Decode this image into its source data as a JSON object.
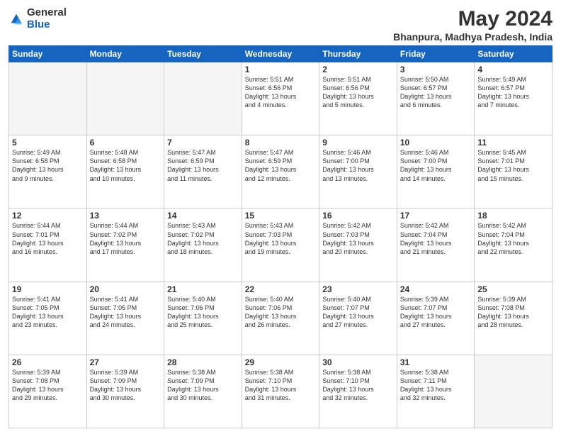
{
  "logo": {
    "general": "General",
    "blue": "Blue"
  },
  "title": "May 2024",
  "subtitle": "Bhanpura, Madhya Pradesh, India",
  "days_of_week": [
    "Sunday",
    "Monday",
    "Tuesday",
    "Wednesday",
    "Thursday",
    "Friday",
    "Saturday"
  ],
  "weeks": [
    [
      {
        "day": "",
        "info": ""
      },
      {
        "day": "",
        "info": ""
      },
      {
        "day": "",
        "info": ""
      },
      {
        "day": "1",
        "info": "Sunrise: 5:51 AM\nSunset: 6:56 PM\nDaylight: 13 hours\nand 4 minutes."
      },
      {
        "day": "2",
        "info": "Sunrise: 5:51 AM\nSunset: 6:56 PM\nDaylight: 13 hours\nand 5 minutes."
      },
      {
        "day": "3",
        "info": "Sunrise: 5:50 AM\nSunset: 6:57 PM\nDaylight: 13 hours\nand 6 minutes."
      },
      {
        "day": "4",
        "info": "Sunrise: 5:49 AM\nSunset: 6:57 PM\nDaylight: 13 hours\nand 7 minutes."
      }
    ],
    [
      {
        "day": "5",
        "info": "Sunrise: 5:49 AM\nSunset: 6:58 PM\nDaylight: 13 hours\nand 9 minutes."
      },
      {
        "day": "6",
        "info": "Sunrise: 5:48 AM\nSunset: 6:58 PM\nDaylight: 13 hours\nand 10 minutes."
      },
      {
        "day": "7",
        "info": "Sunrise: 5:47 AM\nSunset: 6:59 PM\nDaylight: 13 hours\nand 11 minutes."
      },
      {
        "day": "8",
        "info": "Sunrise: 5:47 AM\nSunset: 6:59 PM\nDaylight: 13 hours\nand 12 minutes."
      },
      {
        "day": "9",
        "info": "Sunrise: 5:46 AM\nSunset: 7:00 PM\nDaylight: 13 hours\nand 13 minutes."
      },
      {
        "day": "10",
        "info": "Sunrise: 5:46 AM\nSunset: 7:00 PM\nDaylight: 13 hours\nand 14 minutes."
      },
      {
        "day": "11",
        "info": "Sunrise: 5:45 AM\nSunset: 7:01 PM\nDaylight: 13 hours\nand 15 minutes."
      }
    ],
    [
      {
        "day": "12",
        "info": "Sunrise: 5:44 AM\nSunset: 7:01 PM\nDaylight: 13 hours\nand 16 minutes."
      },
      {
        "day": "13",
        "info": "Sunrise: 5:44 AM\nSunset: 7:02 PM\nDaylight: 13 hours\nand 17 minutes."
      },
      {
        "day": "14",
        "info": "Sunrise: 5:43 AM\nSunset: 7:02 PM\nDaylight: 13 hours\nand 18 minutes."
      },
      {
        "day": "15",
        "info": "Sunrise: 5:43 AM\nSunset: 7:03 PM\nDaylight: 13 hours\nand 19 minutes."
      },
      {
        "day": "16",
        "info": "Sunrise: 5:42 AM\nSunset: 7:03 PM\nDaylight: 13 hours\nand 20 minutes."
      },
      {
        "day": "17",
        "info": "Sunrise: 5:42 AM\nSunset: 7:04 PM\nDaylight: 13 hours\nand 21 minutes."
      },
      {
        "day": "18",
        "info": "Sunrise: 5:42 AM\nSunset: 7:04 PM\nDaylight: 13 hours\nand 22 minutes."
      }
    ],
    [
      {
        "day": "19",
        "info": "Sunrise: 5:41 AM\nSunset: 7:05 PM\nDaylight: 13 hours\nand 23 minutes."
      },
      {
        "day": "20",
        "info": "Sunrise: 5:41 AM\nSunset: 7:05 PM\nDaylight: 13 hours\nand 24 minutes."
      },
      {
        "day": "21",
        "info": "Sunrise: 5:40 AM\nSunset: 7:06 PM\nDaylight: 13 hours\nand 25 minutes."
      },
      {
        "day": "22",
        "info": "Sunrise: 5:40 AM\nSunset: 7:06 PM\nDaylight: 13 hours\nand 26 minutes."
      },
      {
        "day": "23",
        "info": "Sunrise: 5:40 AM\nSunset: 7:07 PM\nDaylight: 13 hours\nand 27 minutes."
      },
      {
        "day": "24",
        "info": "Sunrise: 5:39 AM\nSunset: 7:07 PM\nDaylight: 13 hours\nand 27 minutes."
      },
      {
        "day": "25",
        "info": "Sunrise: 5:39 AM\nSunset: 7:08 PM\nDaylight: 13 hours\nand 28 minutes."
      }
    ],
    [
      {
        "day": "26",
        "info": "Sunrise: 5:39 AM\nSunset: 7:08 PM\nDaylight: 13 hours\nand 29 minutes."
      },
      {
        "day": "27",
        "info": "Sunrise: 5:39 AM\nSunset: 7:09 PM\nDaylight: 13 hours\nand 30 minutes."
      },
      {
        "day": "28",
        "info": "Sunrise: 5:38 AM\nSunset: 7:09 PM\nDaylight: 13 hours\nand 30 minutes."
      },
      {
        "day": "29",
        "info": "Sunrise: 5:38 AM\nSunset: 7:10 PM\nDaylight: 13 hours\nand 31 minutes."
      },
      {
        "day": "30",
        "info": "Sunrise: 5:38 AM\nSunset: 7:10 PM\nDaylight: 13 hours\nand 32 minutes."
      },
      {
        "day": "31",
        "info": "Sunrise: 5:38 AM\nSunset: 7:11 PM\nDaylight: 13 hours\nand 32 minutes."
      },
      {
        "day": "",
        "info": ""
      }
    ]
  ]
}
